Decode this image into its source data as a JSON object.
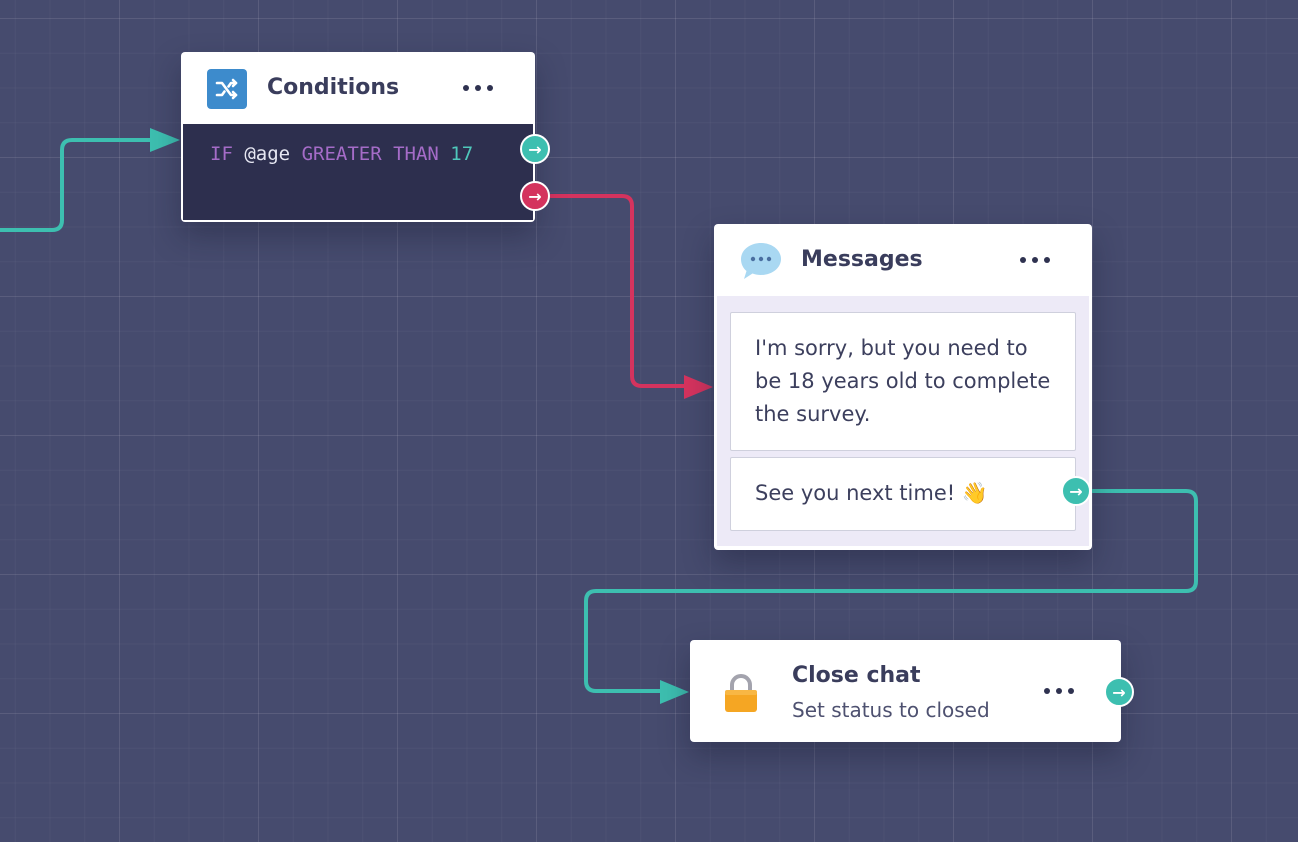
{
  "canvas": {
    "connector_colors": {
      "true_branch": "#3dbfb0",
      "false_branch": "#d4335e"
    }
  },
  "nodes": {
    "conditions": {
      "title": "Conditions",
      "icon": "shuffle-icon",
      "icon_color": "#3d8bcc",
      "condition": {
        "keyword_if": "IF",
        "variable": "@age",
        "operator": "GREATER THAN",
        "value": "17"
      },
      "outputs": [
        "true",
        "false"
      ]
    },
    "messages": {
      "title": "Messages",
      "icon": "speech-bubble-icon",
      "items": [
        "I'm sorry, but you need to be 18 years old to complete the survey.",
        "See you next time! 👋"
      ]
    },
    "close_chat": {
      "title": "Close chat",
      "subtitle": "Set status to closed",
      "icon": "lock-icon",
      "icon_color": "#f5a623"
    }
  }
}
